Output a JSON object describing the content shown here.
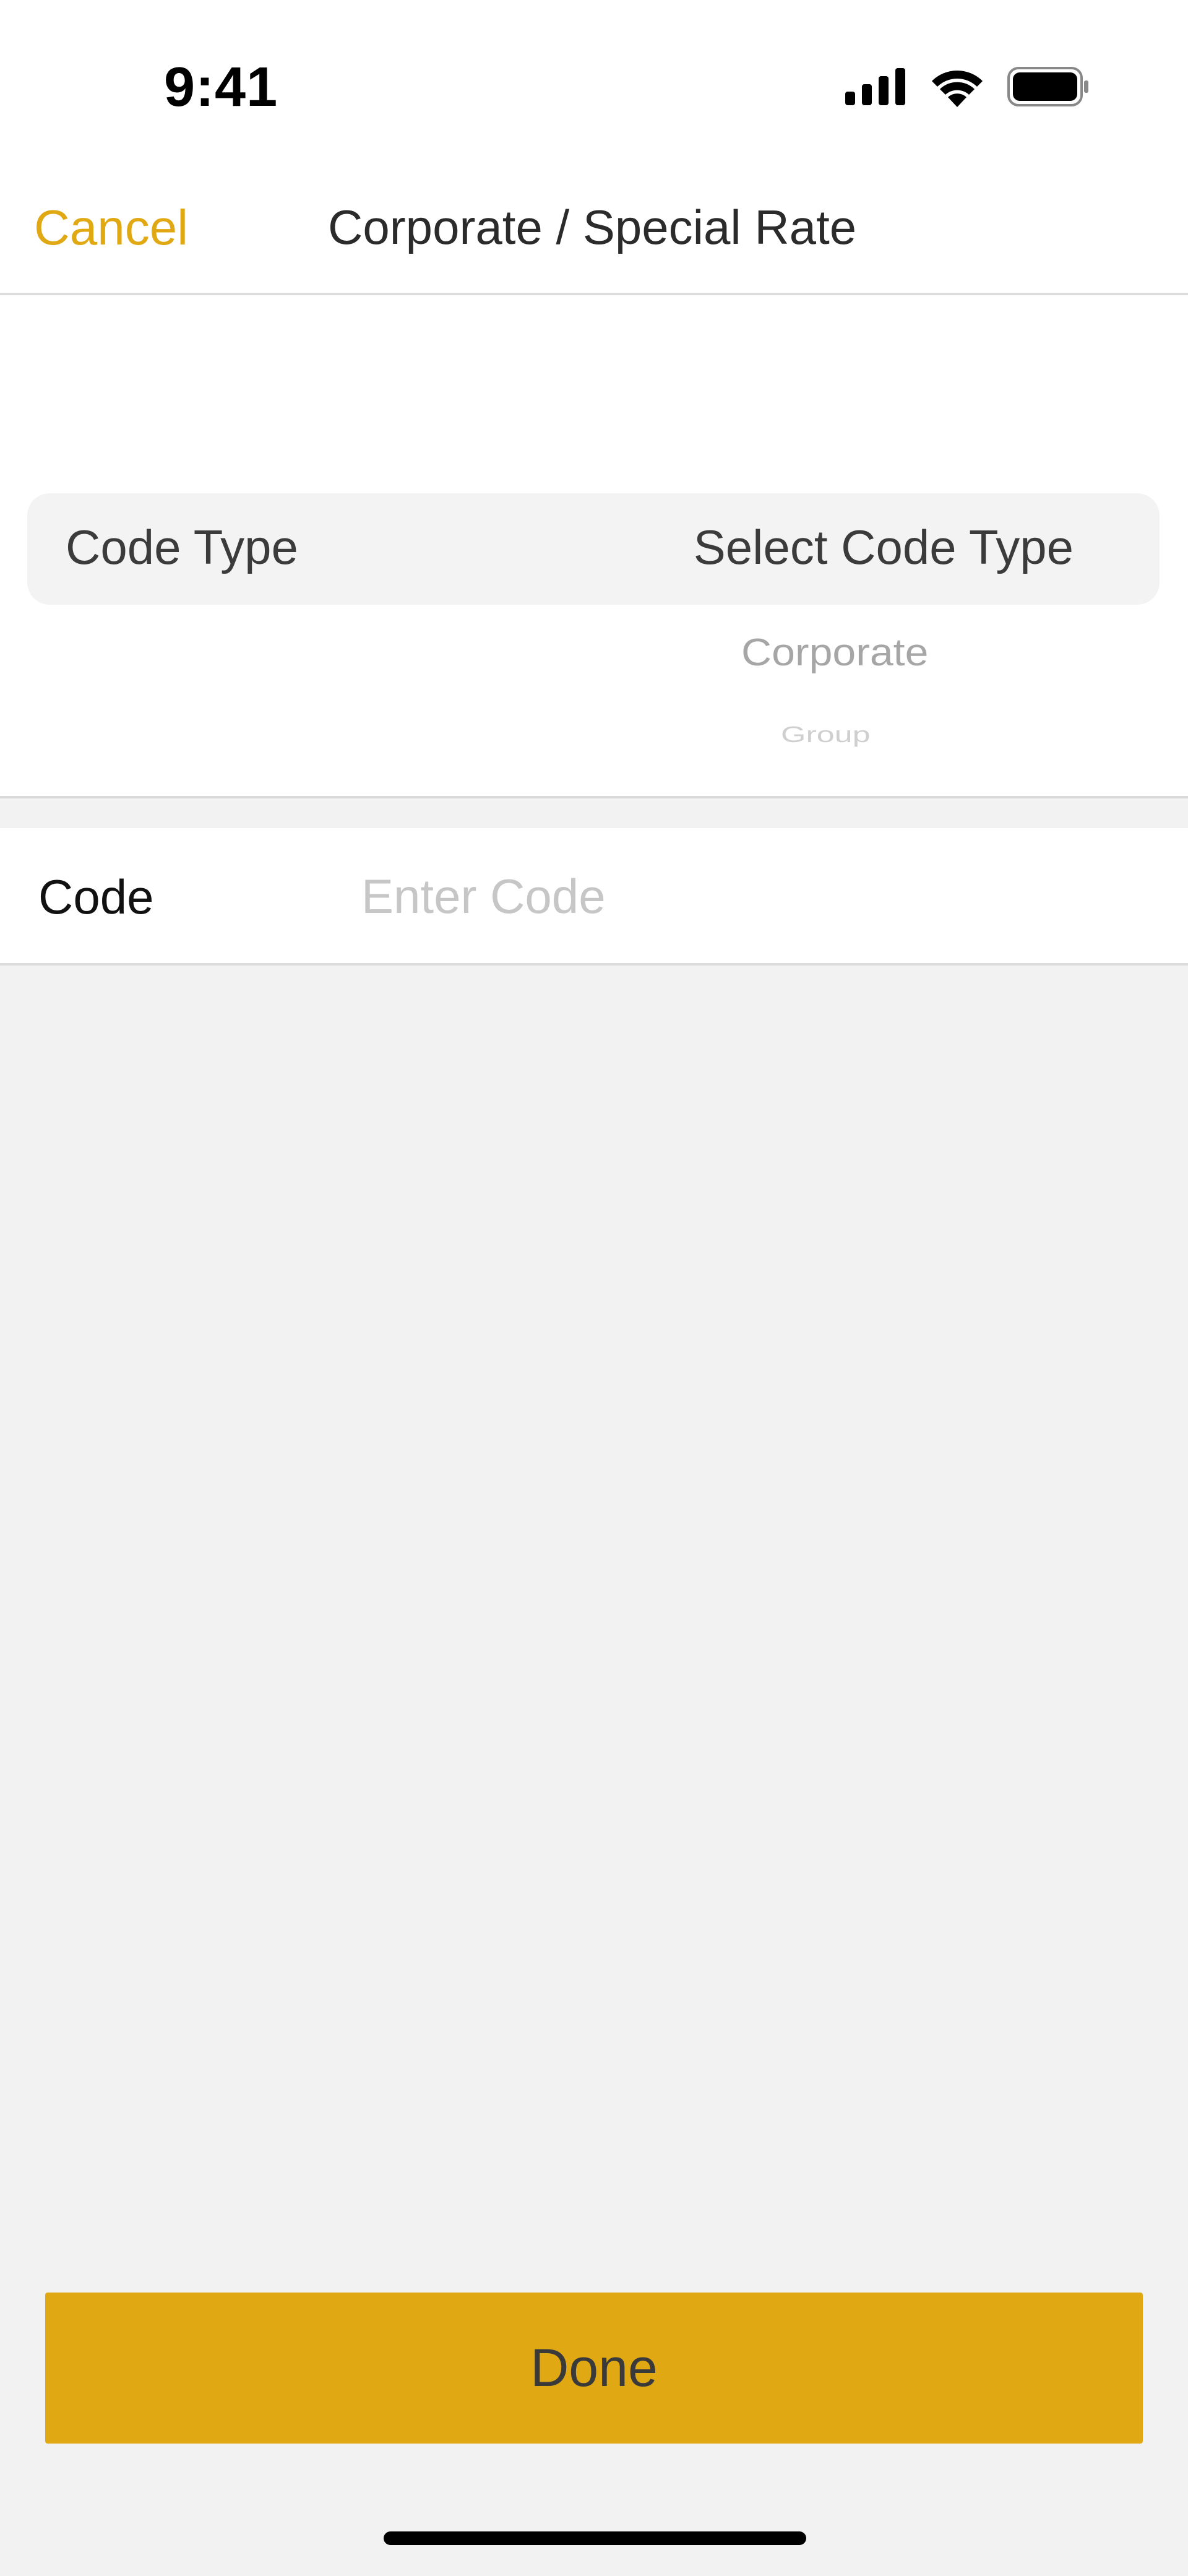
{
  "status_bar": {
    "time": "9:41",
    "icons": [
      "cellular-signal-icon",
      "wifi-icon",
      "battery-icon"
    ]
  },
  "nav": {
    "cancel_label": "Cancel",
    "title": "Corporate / Special Rate"
  },
  "picker": {
    "label": "Code Type",
    "selected": "Select Code Type",
    "options": [
      "Corporate",
      "Group"
    ]
  },
  "code_field": {
    "label": "Code",
    "value": "",
    "placeholder": "Enter Code"
  },
  "footer": {
    "done_label": "Done"
  },
  "colors": {
    "accent": "#e0a914",
    "background": "#f2f2f2"
  }
}
